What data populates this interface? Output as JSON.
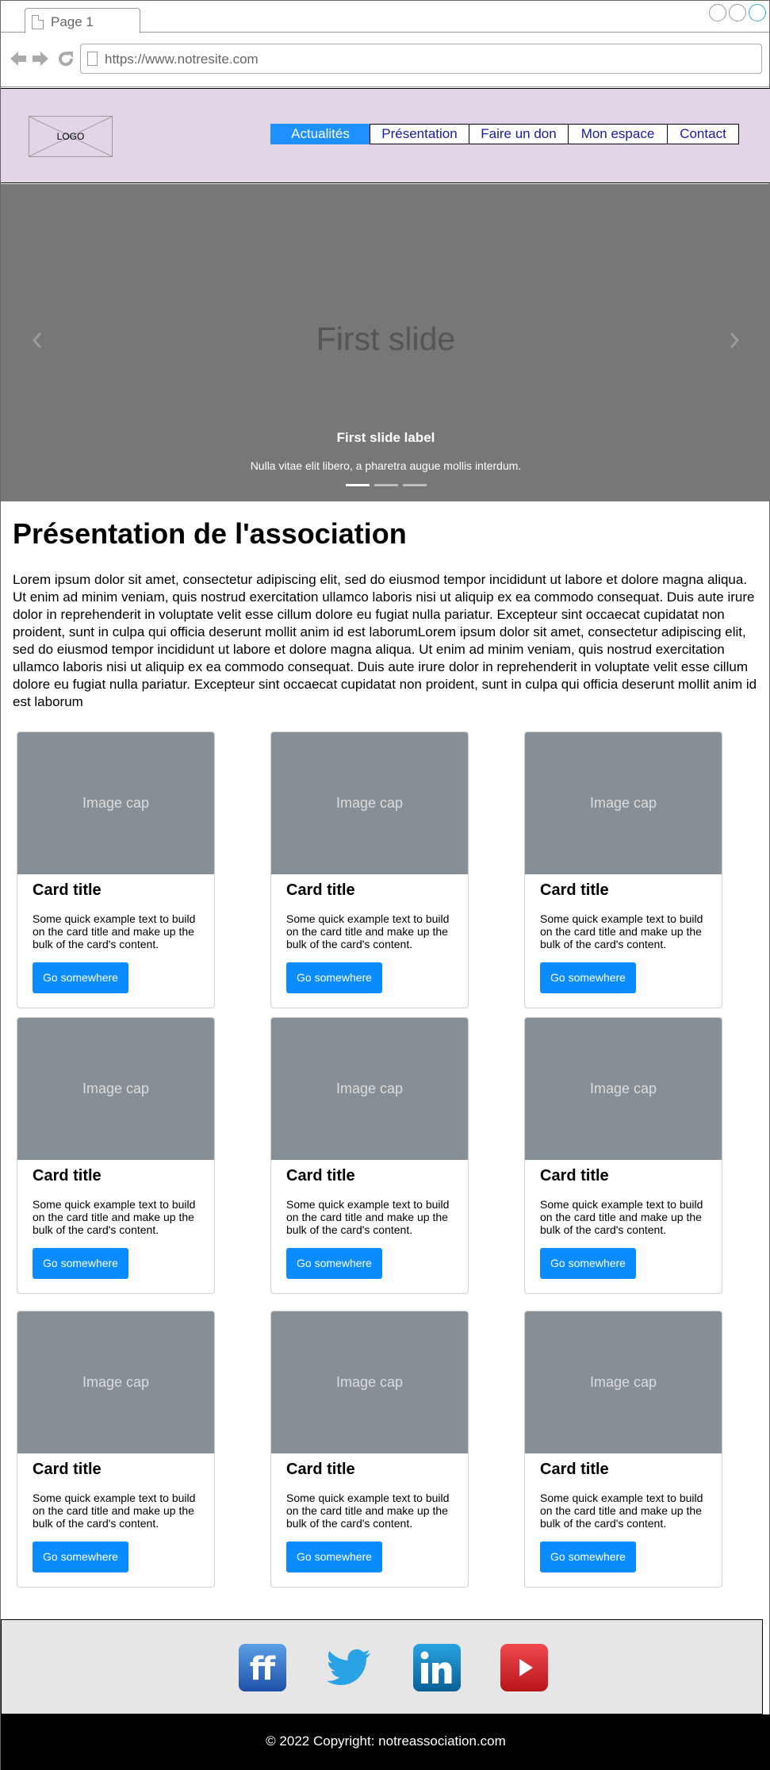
{
  "browser": {
    "tab_label": "Page 1",
    "url": "https://www.notresite.com"
  },
  "header": {
    "logo_text": "LOGO",
    "menu": [
      {
        "label": "Actualités",
        "active": true
      },
      {
        "label": "Présentation",
        "active": false
      },
      {
        "label": "Faire un don",
        "active": false
      },
      {
        "label": "Mon espace",
        "active": false
      },
      {
        "label": "Contact",
        "active": false
      }
    ],
    "bg_color": "#e1d5e7",
    "active_color": "#1e90ff"
  },
  "carousel": {
    "slide_title": "First slide",
    "label": "First slide label",
    "text": "Nulla vitae elit libero, a pharetra augue mollis interdum.",
    "prev_icon": "chevron-left-icon",
    "next_icon": "chevron-right-icon",
    "active_index": 0,
    "indicator_count": 3
  },
  "main": {
    "title": "Présentation de l'association",
    "text": "Lorem ipsum dolor sit amet, consectetur adipiscing elit, sed do eiusmod tempor incididunt ut labore et dolore magna aliqua. Ut enim ad minim veniam, quis nostrud exercitation ullamco laboris nisi ut aliquip ex ea commodo consequat. Duis aute irure dolor in reprehenderit in voluptate velit esse cillum dolore eu fugiat nulla pariatur. Excepteur sint occaecat cupidatat non proident, sunt in culpa qui officia deserunt mollit anim id est laborumLorem ipsum dolor sit amet, consectetur adipiscing elit, sed do eiusmod tempor incididunt ut labore et dolore magna aliqua. Ut enim ad minim veniam, quis nostrud exercitation ullamco laboris nisi ut aliquip ex ea commodo consequat. Duis aute irure dolor in reprehenderit in voluptate velit esse cillum dolore eu fugiat nulla pariatur. Excepteur sint occaecat cupidatat non proident, sunt in culpa qui officia deserunt mollit anim id est laborum"
  },
  "cards": [
    {
      "image": "Image cap",
      "title": "Card title",
      "text": "Some quick example text to build on the card title and make up the bulk of the card's content.",
      "button": "Go somewhere"
    },
    {
      "image": "Image cap",
      "title": "Card title",
      "text": "Some quick example text to build on the card title and make up the bulk of the card's content.",
      "button": "Go somewhere"
    },
    {
      "image": "Image cap",
      "title": "Card title",
      "text": "Some quick example text to build on the card title and make up the bulk of the card's content.",
      "button": "Go somewhere"
    },
    {
      "image": "Image cap",
      "title": "Card title",
      "text": "Some quick example text to build on the card title and make up the bulk of the card's content.",
      "button": "Go somewhere"
    },
    {
      "image": "Image cap",
      "title": "Card title",
      "text": "Some quick example text to build on the card title and make up the bulk of the card's content.",
      "button": "Go somewhere"
    },
    {
      "image": "Image cap",
      "title": "Card title",
      "text": "Some quick example text to build on the card title and make up the bulk of the card's content.",
      "button": "Go somewhere"
    },
    {
      "image": "Image cap",
      "title": "Card title",
      "text": "Some quick example text to build on the card title and make up the bulk of the card's content.",
      "button": "Go somewhere"
    },
    {
      "image": "Image cap",
      "title": "Card title",
      "text": "Some quick example text to build on the card title and make up the bulk of the card's content.",
      "button": "Go somewhere"
    },
    {
      "image": "Image cap",
      "title": "Card title",
      "text": "Some quick example text to build on the card title and make up the bulk of the card's content.",
      "button": "Go somewhere"
    }
  ],
  "footer": {
    "social": [
      {
        "name": "flickr-icon",
        "color": "#1f6fc4"
      },
      {
        "name": "twitter-icon",
        "color": "#2aa3e6"
      },
      {
        "name": "linkedin-icon",
        "color": "#0e7bbd"
      },
      {
        "name": "youtube-icon",
        "color": "#e01f26"
      }
    ],
    "copyright": "© 2022 Copyright: notreassociation.com"
  }
}
